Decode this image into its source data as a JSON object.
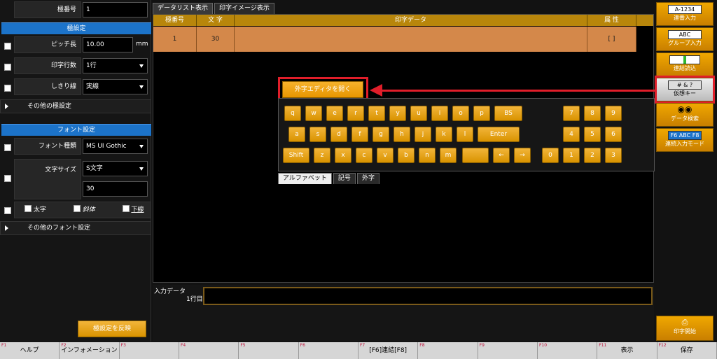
{
  "left": {
    "pole_no": {
      "label": "極番号",
      "value": "1"
    },
    "pole_section": "極設定",
    "pitch": {
      "label": "ピッチ長",
      "value": "10.00",
      "unit": "mm"
    },
    "rows": {
      "label": "印字行数",
      "value": "1行"
    },
    "divider": {
      "label": "しきり線",
      "value": "実線"
    },
    "other_pole": "その他の極設定",
    "font_section": "フォント設定",
    "font_type": {
      "label": "フォント種類",
      "value": "MS UI Gothic"
    },
    "font_size": {
      "label": "文字サイズ",
      "value": "S文字",
      "value2": "30"
    },
    "bold": "太字",
    "italic": "斜体",
    "underline": "下線",
    "other_font": "その他のフォント設定",
    "apply_button": "極設定を反映"
  },
  "tabs": [
    "データリスト表示",
    "印字イメージ表示"
  ],
  "grid": {
    "headers": [
      "極番号",
      "文 字",
      "印字データ",
      "属 性"
    ],
    "row": [
      "1",
      "30",
      "",
      "[ ]"
    ]
  },
  "keyboard": {
    "gaiji_button": "外字エディタを開く",
    "row1": [
      "q",
      "w",
      "e",
      "r",
      "t",
      "y",
      "u",
      "i",
      "o",
      "p",
      "BS"
    ],
    "row2": [
      "a",
      "s",
      "d",
      "f",
      "g",
      "h",
      "j",
      "k",
      "l",
      "Enter"
    ],
    "row3": [
      "Shift",
      "z",
      "x",
      "c",
      "v",
      "b",
      "n",
      "m",
      "",
      "←",
      "→"
    ],
    "num_row1": [
      "7",
      "8",
      "9"
    ],
    "num_row2": [
      "4",
      "5",
      "6"
    ],
    "num_row3": [
      "0",
      "1",
      "2",
      "3"
    ],
    "tabs": [
      "アルファベット",
      "記号",
      "外字"
    ]
  },
  "input": {
    "label": "入力データ",
    "line_label": "1行目",
    "value": ""
  },
  "toolbar": {
    "renban": {
      "label": "連番入力",
      "icon": "A-1234"
    },
    "group": {
      "label": "グループ入力",
      "icon": "ABC"
    },
    "renketsu": {
      "label": "連結読込"
    },
    "virtual": {
      "label": "仮想キー",
      "icon": "# & ?"
    },
    "search": {
      "label": "データ検索"
    },
    "cont_mode": {
      "label": "連続入力モード",
      "icon": "F6 ABC F8"
    },
    "print": {
      "label": "印字開始"
    }
  },
  "footer": [
    {
      "key": "F1",
      "label": "ヘルプ"
    },
    {
      "key": "F2",
      "label": "インフォメーション"
    },
    {
      "key": "F3",
      "label": ""
    },
    {
      "key": "F4",
      "label": ""
    },
    {
      "key": "F5",
      "label": ""
    },
    {
      "key": "F6",
      "label": ""
    },
    {
      "key": "F7",
      "label": "[F6]連結[F8]"
    },
    {
      "key": "F8",
      "label": ""
    },
    {
      "key": "F9",
      "label": ""
    },
    {
      "key": "F10",
      "label": ""
    },
    {
      "key": "F11",
      "label": "表示"
    },
    {
      "key": "F12",
      "label": "保存"
    }
  ],
  "colors": {
    "accent": "#e8a000",
    "section": "#1c73c9",
    "highlight": "#e01e2a"
  }
}
